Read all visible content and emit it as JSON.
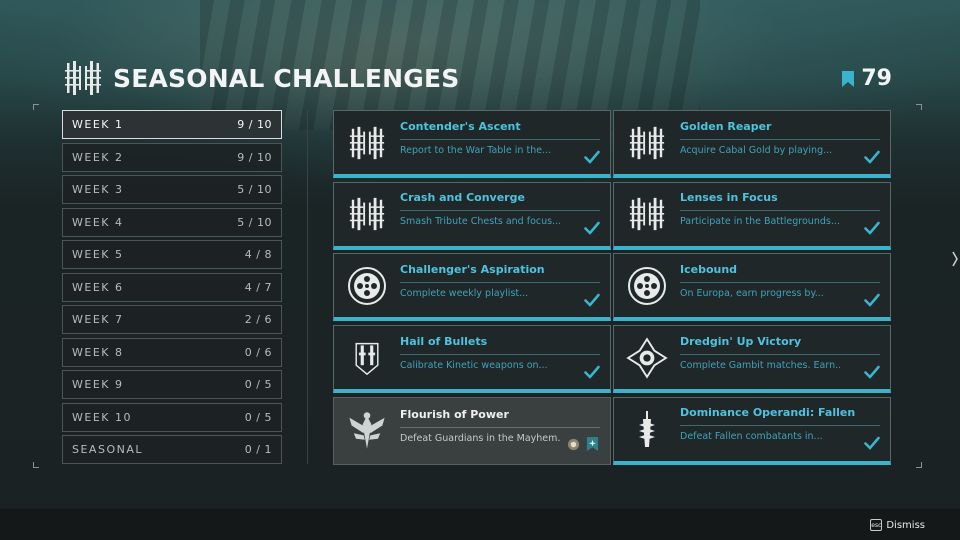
{
  "page": {
    "title": "SEASONAL CHALLENGES",
    "rank": "79",
    "accent": "#3ab4cc"
  },
  "weeks": [
    {
      "label": "WEEK 1",
      "count": "9 / 10",
      "active": true
    },
    {
      "label": "WEEK 2",
      "count": "9 / 10"
    },
    {
      "label": "WEEK 3",
      "count": "5 / 10"
    },
    {
      "label": "WEEK 4",
      "count": "5 / 10"
    },
    {
      "label": "WEEK 5",
      "count": "4 / 8"
    },
    {
      "label": "WEEK 6",
      "count": "4 / 7"
    },
    {
      "label": "WEEK 7",
      "count": "2 / 6"
    },
    {
      "label": "WEEK 8",
      "count": "0 / 6"
    },
    {
      "label": "WEEK 9",
      "count": "0 / 5"
    },
    {
      "label": "WEEK 10",
      "count": "0 / 5"
    },
    {
      "label": "SEASONAL",
      "count": "0 / 1"
    }
  ],
  "challenges": [
    {
      "title": "Contender's Ascent",
      "desc": "Report to the War Table in the...",
      "icon": "seasonal-emblem-icon",
      "complete": true
    },
    {
      "title": "Golden Reaper",
      "desc": "Acquire Cabal Gold by playing...",
      "icon": "seasonal-emblem-icon",
      "complete": true
    },
    {
      "title": "Crash and Converge",
      "desc": "Smash Tribute Chests and focus...",
      "icon": "seasonal-emblem-icon",
      "complete": true
    },
    {
      "title": "Lenses in Focus",
      "desc": "Participate in the Battlegrounds...",
      "icon": "seasonal-emblem-icon",
      "complete": true
    },
    {
      "title": "Challenger's Aspiration",
      "desc": "Complete weekly playlist...",
      "icon": "playlist-icon",
      "complete": true
    },
    {
      "title": "Icebound",
      "desc": "On Europa, earn progress by...",
      "icon": "playlist-icon",
      "complete": true
    },
    {
      "title": "Hail of Bullets",
      "desc": "Calibrate Kinetic weapons on...",
      "icon": "weapons-icon",
      "complete": true
    },
    {
      "title": "Dredgin' Up Victory",
      "desc": "Complete Gambit matches. Earn...",
      "icon": "gambit-icon",
      "complete": true
    },
    {
      "title": "Flourish of Power",
      "desc": "Defeat Guardians in the Mayhem...",
      "icon": "crucible-icon",
      "complete": false
    },
    {
      "title": "Dominance Operandi: Fallen",
      "desc": "Defeat Fallen combatants in...",
      "icon": "fallen-icon",
      "complete": true
    }
  ],
  "footer": {
    "dismiss_label": "Dismiss",
    "dismiss_key": "esc"
  }
}
